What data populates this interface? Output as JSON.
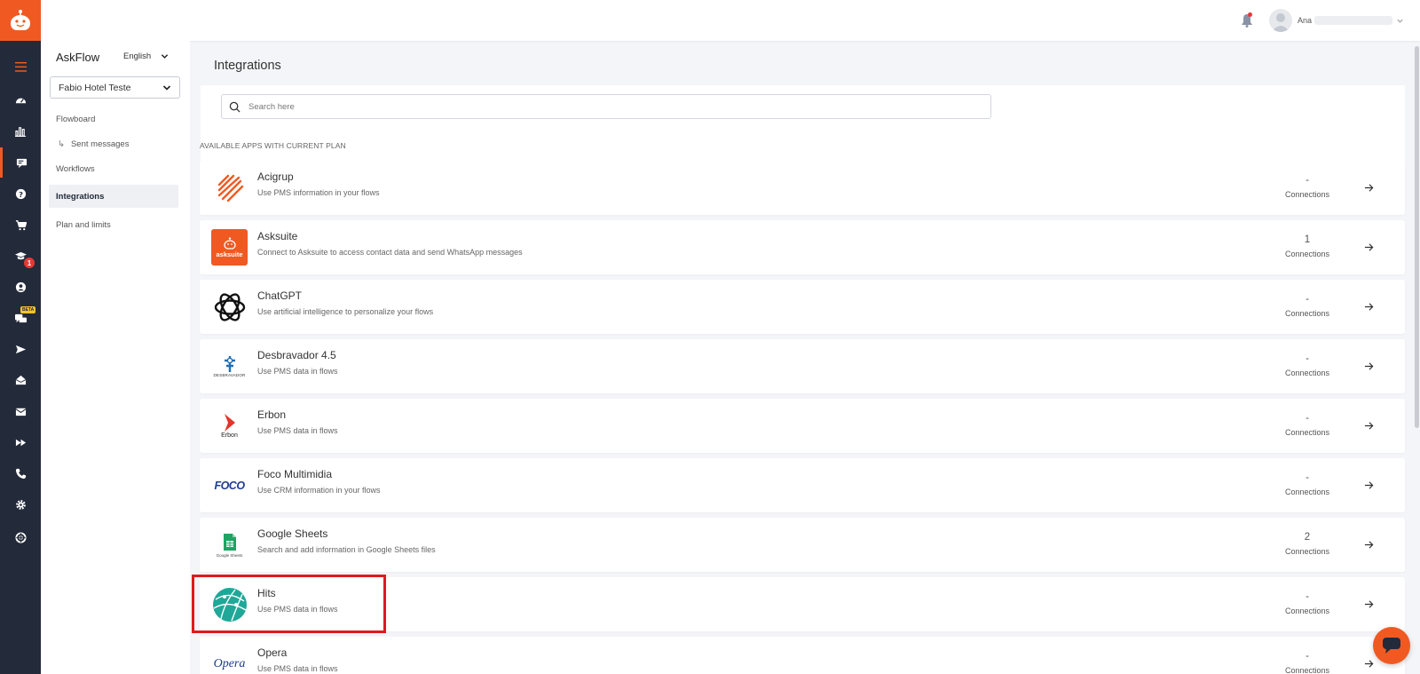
{
  "colors": {
    "brand": "#f05a22",
    "rail_bg": "#232a3a",
    "highlight": "#e0191e"
  },
  "topbar": {
    "user_name": "Ana",
    "notification_dot": true
  },
  "rail": {
    "items": [
      {
        "icon": "menu-icon",
        "active": false
      },
      {
        "icon": "dashboard-icon",
        "active": false
      },
      {
        "icon": "bar-chart-icon",
        "active": false
      },
      {
        "icon": "chat-flow-icon",
        "active": true
      },
      {
        "icon": "help-icon",
        "active": false
      },
      {
        "icon": "cart-icon",
        "active": false
      },
      {
        "icon": "graduation-cap-icon",
        "active": false,
        "badge": "1"
      },
      {
        "icon": "user-circle-icon",
        "active": false
      },
      {
        "icon": "chat-beta-icon",
        "active": false,
        "tag": "BETA"
      },
      {
        "icon": "send-icon",
        "active": false
      },
      {
        "icon": "inbox-icon",
        "active": false
      },
      {
        "icon": "mail-icon",
        "active": false
      },
      {
        "icon": "fast-forward-icon",
        "active": false
      },
      {
        "icon": "phone-icon",
        "active": false
      },
      {
        "icon": "gear-icon",
        "active": false
      },
      {
        "icon": "lifebuoy-icon",
        "active": false
      }
    ]
  },
  "sidebar": {
    "brand": "AskFlow",
    "language": "English",
    "hotel": "Fabio Hotel Teste",
    "nav": [
      {
        "label": "Flowboard"
      },
      {
        "label": "Sent messages",
        "sub": true
      },
      {
        "label": "Workflows"
      },
      {
        "label": "Integrations",
        "active": true
      },
      {
        "label": "Plan and limits"
      }
    ]
  },
  "main": {
    "title": "Integrations",
    "search_placeholder": "Search here",
    "section_label": "AVAILABLE APPS WITH CURRENT PLAN",
    "connections_label": "Connections",
    "integrations": [
      {
        "name": "Acigrup",
        "description": "Use PMS information in your flows",
        "connections": "-",
        "logo": "acigrup-logo"
      },
      {
        "name": "Asksuite",
        "description": "Connect to Asksuite to access contact data and send WhatsApp messages",
        "connections": "1",
        "logo": "asksuite-logo",
        "logo_text": "asksuite"
      },
      {
        "name": "ChatGPT",
        "description": "Use artificial intelligence to personalize your flows",
        "connections": "-",
        "logo": "openai-logo"
      },
      {
        "name": "Desbravador 4.5",
        "description": "Use PMS data in flows",
        "connections": "-",
        "logo": "desbravador-logo",
        "logo_text": "DESBRAVADOR"
      },
      {
        "name": "Erbon",
        "description": "Use PMS data in flows",
        "connections": "-",
        "logo": "erbon-logo",
        "logo_text": "Erbon"
      },
      {
        "name": "Foco Multimidia",
        "description": "Use CRM information in your flows",
        "connections": "-",
        "logo": "foco-logo",
        "logo_text": "FOCO"
      },
      {
        "name": "Google Sheets",
        "description": "Search and add information in Google Sheets files",
        "connections": "2",
        "logo": "google-sheets-logo",
        "logo_text": "Google Sheets"
      },
      {
        "name": "Hits",
        "description": "Use PMS data in flows",
        "connections": "-",
        "logo": "hits-logo"
      },
      {
        "name": "Opera",
        "description": "Use PMS data in flows",
        "connections": "-",
        "logo": "opera-logo",
        "logo_text": "Opera"
      }
    ]
  }
}
